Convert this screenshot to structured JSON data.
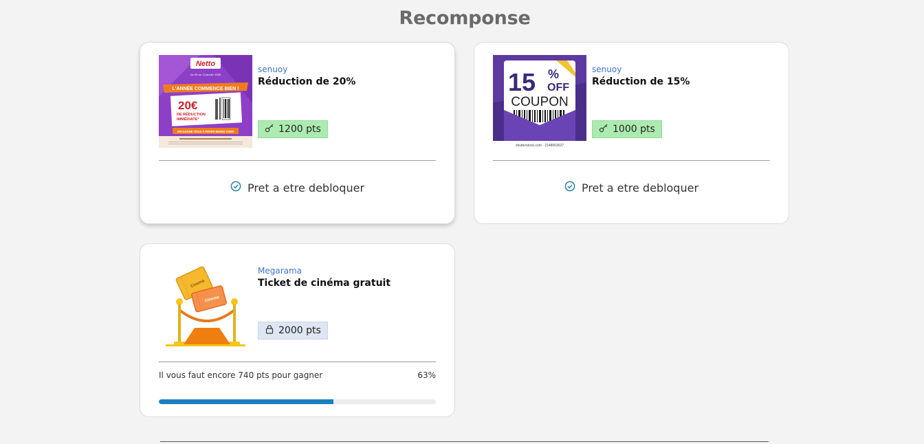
{
  "page": {
    "title": "Recomponse"
  },
  "rewards": [
    {
      "brand": "senuoy",
      "title": "Réduction de 20%",
      "points": "1200 pts",
      "status": "Pret a etre debloquer",
      "badge_icon": "key-icon",
      "image": {
        "logo": "Netto",
        "dates": "Du 06 au 11 janvier 2025",
        "banner": "L'ANNÉE COMMENCE BIEN !",
        "amount": "20€",
        "line1": "DE RÉDUCTION",
        "line2": "IMMÉDIATE*",
        "slogan": "ON GAGNE TOUS À PAYER MOINS CHER"
      }
    },
    {
      "brand": "senuoy",
      "title": "Réduction de 15%",
      "points": "1000 pts",
      "status": "Pret a etre debloquer",
      "badge_icon": "key-icon",
      "image": {
        "number": "15",
        "percent": "%",
        "off": "OFF",
        "coupon": "COUPON",
        "credit": "shutterstock.com · 2148663627"
      }
    },
    {
      "brand": "Megarama",
      "title": "Ticket de cinéma gratuit",
      "points": "2000 pts",
      "badge_icon": "lock-icon",
      "progress_text": "Il vous faut encore 740 pts pour gagner",
      "progress_label": "63%",
      "progress": 0.63,
      "image": {
        "ticket_label": "Cinema"
      }
    }
  ],
  "colors": {
    "brand_text": "#3d74c9",
    "unlocked_badge": "#acebb0",
    "locked_badge": "#dde6f2",
    "progress_fill": "#1d7fbf",
    "check_icon": "#2a7fa8"
  }
}
